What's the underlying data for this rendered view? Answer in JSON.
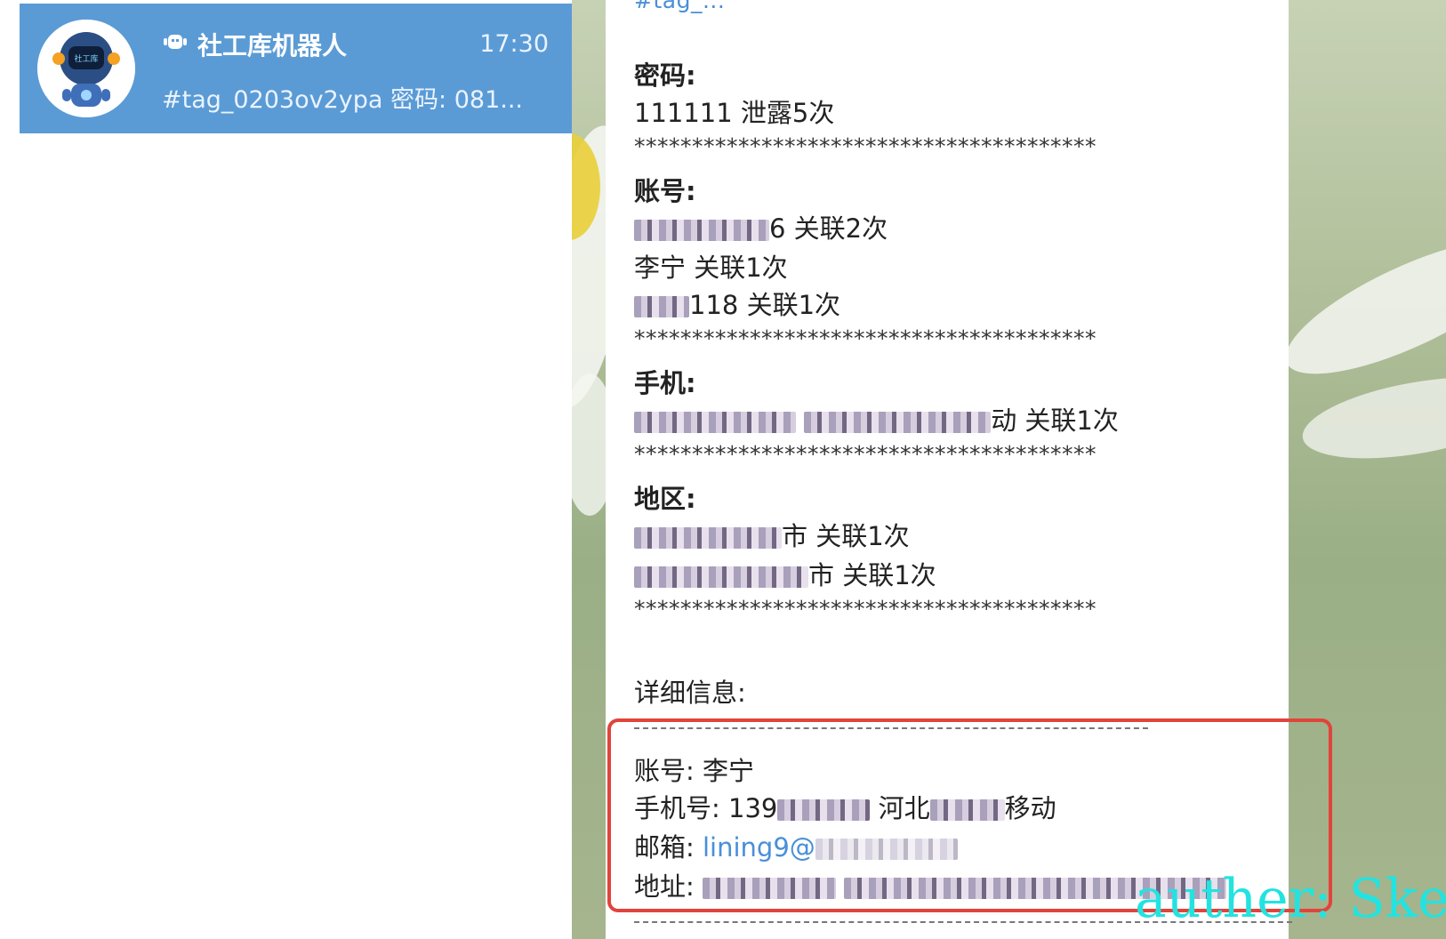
{
  "chat_list": {
    "item": {
      "name": "社工库机器人",
      "time": "17:30",
      "preview": "#tag_0203ov2ypa 密码: 081...",
      "avatar_text": "社工库"
    }
  },
  "message": {
    "top_cut": "#tag_...",
    "password_heading": "密码:",
    "password_value": "111111 泄露5次",
    "separator": "****************************************",
    "account_heading": "账号:",
    "account_1_suffix": "6 关联2次",
    "account_2": "李宁 关联1次",
    "account_3_suffix": "118 关联1次",
    "phone_heading": "手机:",
    "phone_suffix": "动 关联1次",
    "region_heading": "地区:",
    "region_1_suffix": "市 关联1次",
    "region_2_suffix": "市 关联1次",
    "detail_heading": "详细信息:",
    "detail_account": "账号: 李宁",
    "detail_phone_label": "手机号: 139",
    "detail_phone_suffix": "河北",
    "detail_phone_end": "移动",
    "detail_email_label": "邮箱:",
    "detail_email_value": "lining9@",
    "detail_address_label": "地址:"
  },
  "watermark": "auther: Ske"
}
